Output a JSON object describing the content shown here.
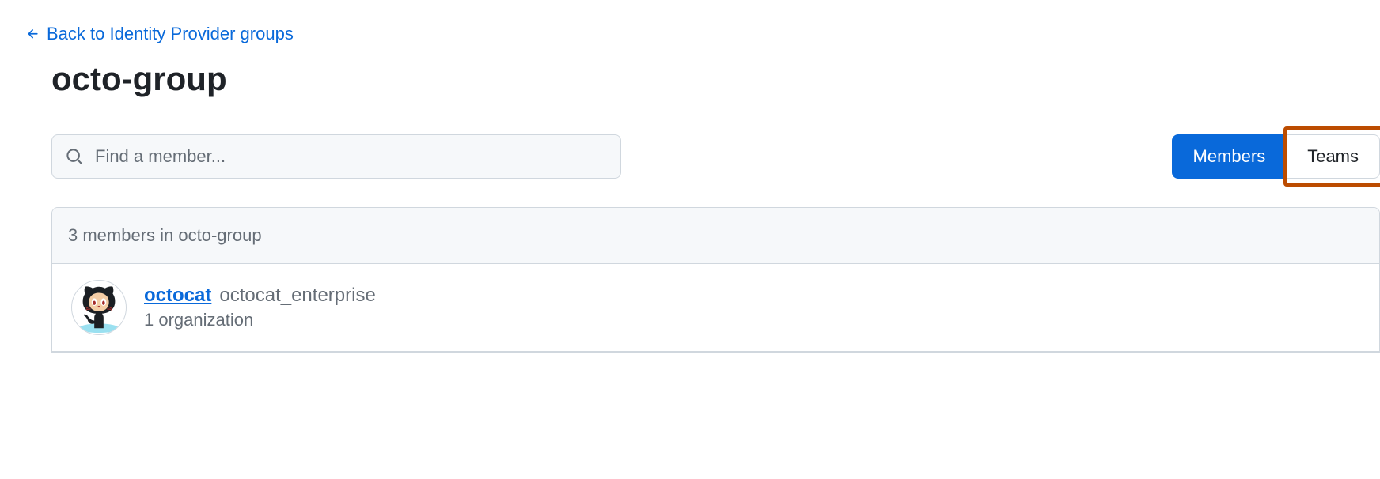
{
  "back_link": {
    "label": "Back to Identity Provider groups"
  },
  "page_title": "octo-group",
  "search": {
    "placeholder": "Find a member..."
  },
  "tabs": {
    "members": "Members",
    "teams": "Teams"
  },
  "list": {
    "header": "3 members in octo-group",
    "items": [
      {
        "username": "octocat",
        "fullname": "octocat_enterprise",
        "meta": "1 organization"
      }
    ]
  }
}
